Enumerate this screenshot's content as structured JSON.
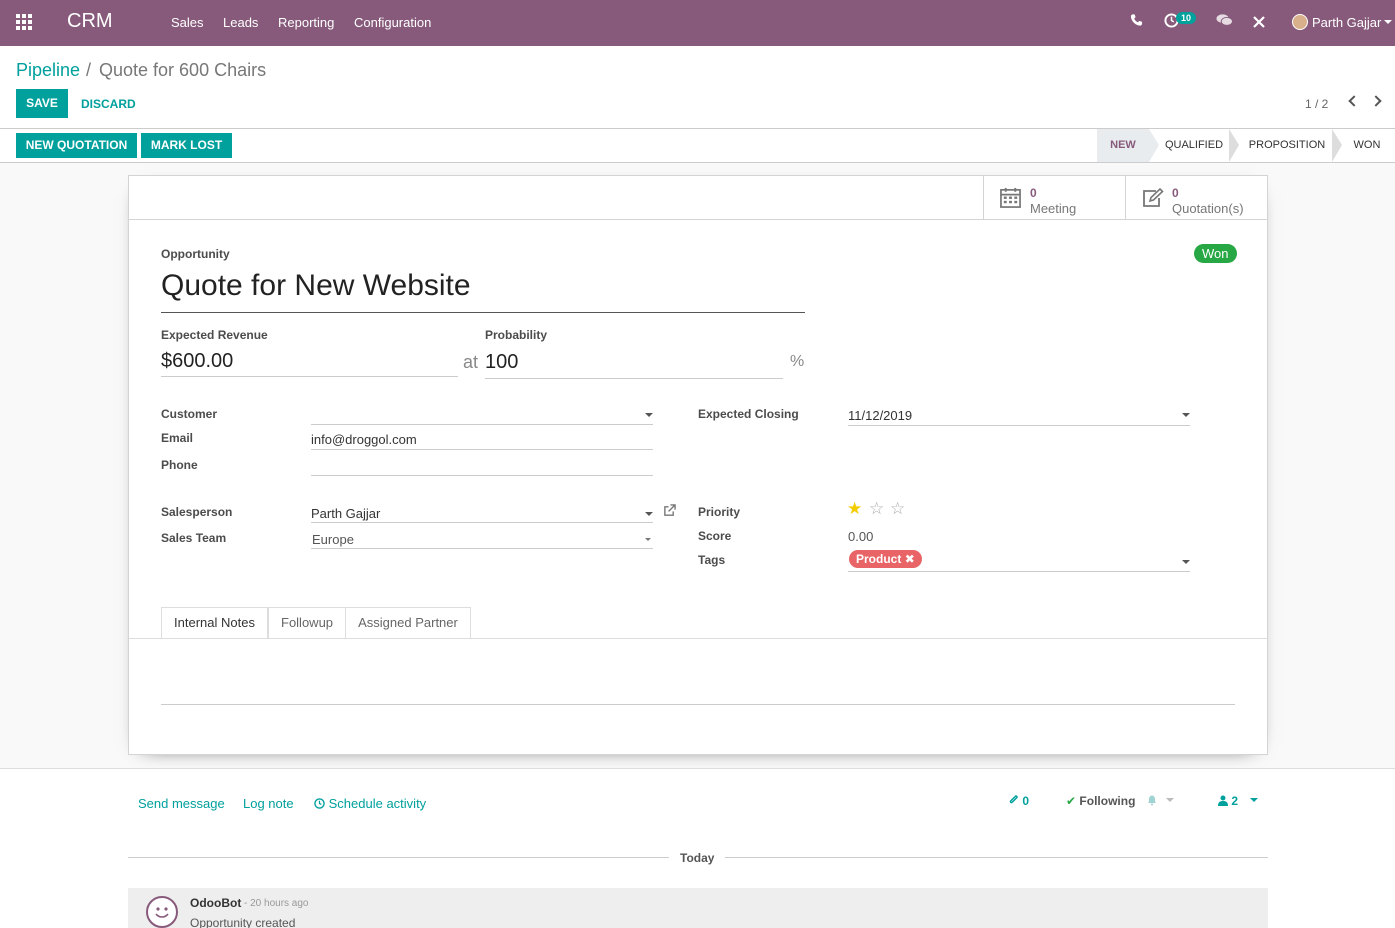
{
  "navbar": {
    "app_title": "CRM",
    "menus": [
      "Sales",
      "Leads",
      "Reporting",
      "Configuration"
    ],
    "activity_count": "10",
    "user_name": "Parth Gajjar"
  },
  "breadcrumb": {
    "parent": "Pipeline",
    "separator": "/",
    "current": "Quote for 600 Chairs"
  },
  "toolbar": {
    "save_label": "Save",
    "discard_label": "Discard",
    "pager": "1 / 2"
  },
  "actions": {
    "new_quotation": "New Quotation",
    "mark_lost": "Mark Lost"
  },
  "stages": [
    "New",
    "Qualified",
    "Proposition",
    "Won"
  ],
  "active_stage": "New",
  "smart_buttons": {
    "meeting_count": "0",
    "meeting_label": "Meeting",
    "quotation_count": "0",
    "quotation_label": "Quotation(s)"
  },
  "form": {
    "opportunity_label": "Opportunity",
    "name": "Quote for New Website",
    "won_badge": "Won",
    "expected_revenue_label": "Expected Revenue",
    "expected_revenue": "$600.00",
    "at_label": "at",
    "probability_label": "Probability",
    "probability": "100",
    "percent": "%",
    "customer_label": "Customer",
    "customer": "",
    "email_label": "Email",
    "email": "info@droggol.com",
    "phone_label": "Phone",
    "phone": "",
    "salesperson_label": "Salesperson",
    "salesperson": "Parth Gajjar",
    "sales_team_label": "Sales Team",
    "sales_team": "Europe",
    "expected_closing_label": "Expected Closing",
    "expected_closing": "11/12/2019",
    "priority_label": "Priority",
    "priority_stars": 1,
    "priority_max": 3,
    "score_label": "Score",
    "score": "0.00",
    "tags_label": "Tags",
    "tags": [
      "Product"
    ]
  },
  "tabs": [
    "Internal Notes",
    "Followup",
    "Assigned Partner"
  ],
  "chatter": {
    "send_message": "Send message",
    "log_note": "Log note",
    "schedule_activity": "Schedule activity",
    "attachments": "0",
    "following": "Following",
    "followers": "2",
    "today": "Today",
    "messages": [
      {
        "author": "OdooBot",
        "time": "- 20 hours ago",
        "body": "Opportunity created"
      }
    ]
  },
  "colors": {
    "brand": "#875a7b",
    "accent": "#00a09d",
    "won": "#28a745",
    "tag": "#e86466",
    "star": "#f3cc00"
  }
}
